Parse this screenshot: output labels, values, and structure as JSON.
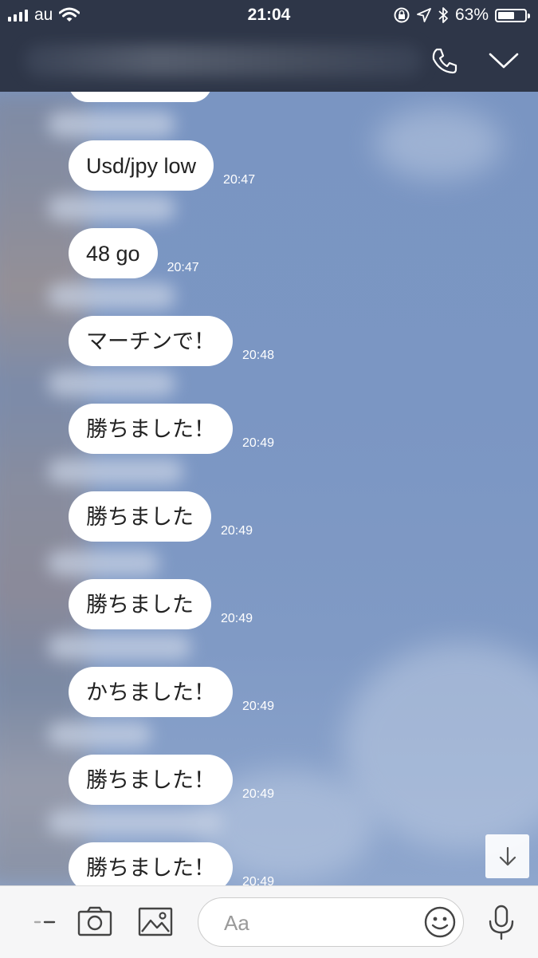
{
  "status_bar": {
    "carrier": "au",
    "time": "21:04",
    "battery_percent": "63%",
    "battery_level": 0.63,
    "icons": [
      "signal-icon",
      "wifi-icon",
      "rotation-lock-icon",
      "location-icon",
      "bluetooth-icon",
      "battery-icon"
    ]
  },
  "header": {
    "buttons": [
      "phone-icon",
      "chevron-down-icon"
    ]
  },
  "messages": [
    {
      "text": "Usd/jpy low",
      "time": "20:47"
    },
    {
      "text": "48 go",
      "time": "20:47"
    },
    {
      "text": "マーチンで！",
      "time": "20:48"
    },
    {
      "text": "勝ちました！",
      "time": "20:49"
    },
    {
      "text": "勝ちました",
      "time": "20:49"
    },
    {
      "text": "勝ちました",
      "time": "20:49"
    },
    {
      "text": "かちました！",
      "time": "20:49"
    },
    {
      "text": "勝ちました！",
      "time": "20:49"
    },
    {
      "text": "勝ちました！",
      "time": "20:49"
    }
  ],
  "input_bar": {
    "placeholder": "Aa",
    "icons": [
      "more-icon",
      "camera-icon",
      "image-icon",
      "emoji-icon",
      "microphone-icon"
    ]
  },
  "colors": {
    "header_bg": "#2e3648",
    "chat_bg": "#7b96c3",
    "bubble_bg": "#ffffff"
  }
}
